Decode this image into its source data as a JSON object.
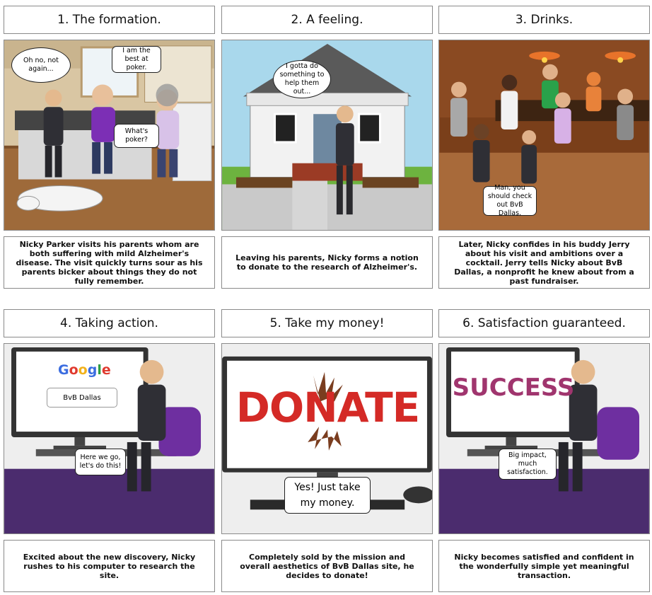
{
  "panels": [
    {
      "title": "1. The formation.",
      "caption": "Nicky Parker visits his parents whom are both suffering with mild Alzheimer's disease. The visit quickly turns sour as his parents bicker about things they do not fully remember.",
      "bubbles": [
        "Oh no, not again...",
        "I am the best at poker.",
        "What's poker?"
      ]
    },
    {
      "title": "2. A feeling.",
      "caption": "Leaving his parents, Nicky forms a notion to donate to the research of Alzheimer's.",
      "bubbles": [
        "I gotta do something to help them out..."
      ]
    },
    {
      "title": "3. Drinks.",
      "caption": "Later, Nicky confides in his buddy Jerry about his visit and ambitions over a cocktail. Jerry tells Nicky about BvB Dallas, a nonprofit he knew about from a past fundraiser.",
      "bubbles": [
        "Man, you should check out BvB Dallas."
      ]
    },
    {
      "title": "4. Taking action.",
      "caption": "Excited about the new discovery, Nicky rushes to his computer to research the site.",
      "bubbles": [
        "Here we go, let's do this!"
      ],
      "screen": {
        "logo_letters": [
          "G",
          "o",
          "o",
          "g",
          "l",
          "e"
        ],
        "logo_colors": [
          "#3b6de0",
          "#e03a2e",
          "#f2b21c",
          "#3b6de0",
          "#2e9c45",
          "#e03a2e"
        ],
        "search_value": "BvB Dallas"
      }
    },
    {
      "title": "5. Take my money!",
      "caption": "Completely sold by the mission and overall aesthetics of BvB Dallas site, he decides to donate!",
      "bubbles": [
        "Yes! Just take my money."
      ],
      "screen": {
        "word": "DONATE",
        "color": "#d42a26"
      }
    },
    {
      "title": "6. Satisfaction guaranteed.",
      "caption": "Nicky becomes satisfied and confident in the wonderfully simple yet meaningful transaction.",
      "bubbles": [
        "Big impact, much satisfaction."
      ],
      "screen": {
        "word": "SUCCESS",
        "color": "#a0356e"
      }
    }
  ]
}
